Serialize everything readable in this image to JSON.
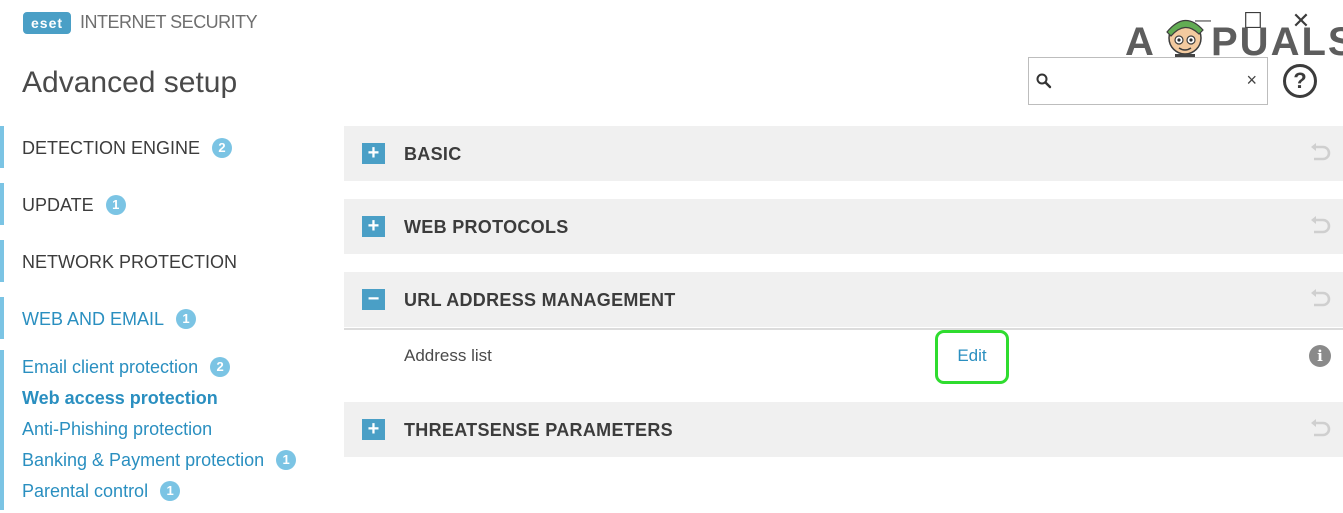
{
  "app": {
    "logo_text": "eset",
    "product_name": "INTERNET SECURITY"
  },
  "window": {
    "minimize_glyph": "—",
    "maximize_glyph": "☐",
    "close_glyph": "✕"
  },
  "watermark": {
    "text_a": "A",
    "text_rest": "PUALS"
  },
  "header": {
    "page_title": "Advanced setup",
    "search_placeholder": "",
    "search_clear": "×",
    "help_glyph": "?"
  },
  "sidebar": {
    "items": [
      {
        "label": "DETECTION ENGINE",
        "badge": "2"
      },
      {
        "label": "UPDATE",
        "badge": "1"
      },
      {
        "label": "NETWORK PROTECTION",
        "badge": ""
      },
      {
        "label": "WEB AND EMAIL",
        "badge": "1"
      }
    ],
    "sub_items": [
      {
        "label": "Email client protection",
        "badge": "2"
      },
      {
        "label": "Web access protection",
        "badge": ""
      },
      {
        "label": "Anti-Phishing protection",
        "badge": ""
      },
      {
        "label": "Banking & Payment protection",
        "badge": "1"
      },
      {
        "label": "Parental control",
        "badge": "1"
      }
    ]
  },
  "sections": [
    {
      "title": "BASIC",
      "toggle": "+"
    },
    {
      "title": "WEB PROTOCOLS",
      "toggle": "+"
    },
    {
      "title": "URL ADDRESS MANAGEMENT",
      "toggle": "−"
    },
    {
      "title": "THREATSENSE PARAMETERS",
      "toggle": "+"
    }
  ],
  "url_management": {
    "row_label": "Address list",
    "edit_label": "Edit",
    "info_glyph": "i"
  },
  "colors": {
    "accent": "#4a9fc6",
    "badge": "#7bc4e4",
    "link": "#2a8fc0",
    "highlight": "#2fdc2f",
    "section_bg": "#f0f0f0"
  }
}
